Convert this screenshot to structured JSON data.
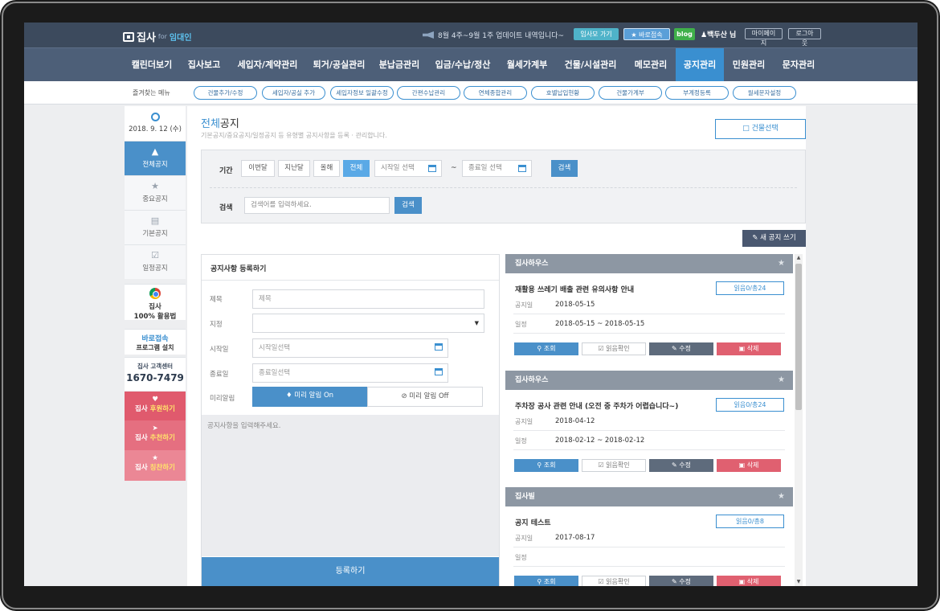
{
  "topbar": {
    "logo_text": "집사",
    "logo_for": "for",
    "logo_brand": "임대인",
    "notice": "8월 4주~9월 1주 업데이트 내역입니다~",
    "intro_btn": "임사모 가기",
    "direct_btn": "바로접속",
    "blog_btn": "blog",
    "user": "백두산 님",
    "mypage_btn": "마이페이지",
    "logout_btn": "로그아웃"
  },
  "mainnav": {
    "items": [
      "캘린더보기",
      "집사보고",
      "세입자/계약관리",
      "퇴거/공실관리",
      "분납금관리",
      "입금/수납/정산",
      "월세가계부",
      "건물/시설관리",
      "메모관리",
      "공지관리",
      "민원관리",
      "문자관리"
    ],
    "active": "공지관리"
  },
  "favbar": {
    "label": "즐겨찾는 메뉴",
    "items": [
      "건물추가/수정",
      "세입자/공실 추가",
      "세입자정보 일괄수정",
      "간편수납관리",
      "연체종합관리",
      "호별납입현황",
      "건물가계부",
      "부계정등록",
      "월세문자설정"
    ]
  },
  "sidebar": {
    "date": "2018. 9. 12 (수)",
    "items": [
      "전체공지",
      "중요공지",
      "기본공지",
      "일정공지"
    ],
    "active": "전체공지",
    "usage_line1": "집사",
    "usage_line2": "100% 활용법",
    "direct_line1": "바로접속",
    "direct_line2": "프로그램 설치",
    "center_label": "집사 고객센터",
    "center_phone": "1670-7479",
    "support": {
      "pre": "집사 ",
      "hi": "후원하기"
    },
    "recommend": {
      "pre": "집사 ",
      "hi": "추천하기"
    },
    "praise": {
      "pre": "집사 ",
      "hi": "칭찬하기"
    }
  },
  "page": {
    "title_blue": "전체",
    "title_rest": "공지",
    "subtitle": "기본공지/중요공지/일정공지 등 유형별 공지사항을 등록 · 관리합니다.",
    "building_btn": "건물선택",
    "new_btn": "새 공지 쓰기"
  },
  "filter": {
    "period_label": "기간",
    "period_btns": [
      "이번달",
      "지난달",
      "올해",
      "전체"
    ],
    "period_active": "전체",
    "start_placeholder": "시작일 선택",
    "tilde": "~",
    "end_placeholder": "종료일 선택",
    "search_btn": "검색",
    "search_label": "검색",
    "search_placeholder": "검색어를 입력하세요.",
    "search_btn2": "검색"
  },
  "form": {
    "title": "공지사항 등록하기",
    "subject_label": "제목",
    "subject_placeholder": "제목",
    "assign_label": "지정",
    "start_label": "시작일",
    "start_placeholder": "시작일선택",
    "end_label": "종료일",
    "end_placeholder": "종료일선택",
    "alarm_label": "미리알림",
    "alarm_on": "미리 알림 On",
    "alarm_off": "미리 알림 Off",
    "body_placeholder": "공지사항을 입력해주세요.",
    "submit": "등록하기"
  },
  "notices": [
    {
      "group": "집사하우스",
      "title": "재활용 쓰레기 배출 관련 유의사항 안내",
      "read": "읽음0/총24",
      "date_label": "공지일",
      "date": "2018-05-15",
      "sched_label": "일정",
      "sched": "2018-05-15 ~ 2018-05-15"
    },
    {
      "group": "집사하우스",
      "title": "주차장 공사 관련 안내 (오전 중 주차가 어렵습니다~)",
      "read": "읽음0/총24",
      "date_label": "공지일",
      "date": "2018-04-12",
      "sched_label": "일정",
      "sched": "2018-02-12 ~ 2018-02-12"
    },
    {
      "group": "집사빌",
      "title": "공지 테스트",
      "read": "읽음0/총8",
      "date_label": "공지일",
      "date": "2017-08-17",
      "sched_label": "일정",
      "sched": ""
    }
  ],
  "card_actions": {
    "view": "조회",
    "read": "읽음확인",
    "edit": "수정",
    "delete": "삭제"
  },
  "colors": {
    "primary": "#4a90c9",
    "nav": "#4d5f78",
    "topbar": "#3c4a5d",
    "danger": "#e06070"
  }
}
